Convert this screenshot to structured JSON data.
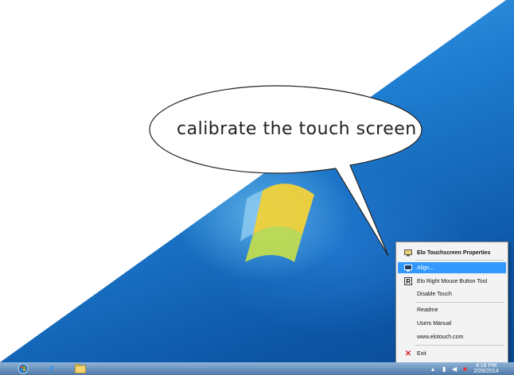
{
  "callout": {
    "text": "calibrate the touch screen"
  },
  "context_menu": {
    "items": [
      {
        "id": "elo-touchscreen-properties",
        "label": "Elo Touchscreen Properties",
        "icon": "elo-monitor-icon",
        "style": "bold"
      },
      {
        "id": "align",
        "label": "Align...",
        "icon": "align-monitor-icon",
        "style": "selected"
      },
      {
        "id": "elo-right-mouse-button-tool",
        "label": "Elo Right Mouse Button Tool",
        "icon": "right-button-r-icon",
        "style": "normal"
      },
      {
        "id": "disable-touch",
        "label": "Disable Touch",
        "style": "plain"
      },
      {
        "id": "readme",
        "label": "Readme",
        "style": "plain"
      },
      {
        "id": "users-manual",
        "label": "Users Manual",
        "style": "plain"
      },
      {
        "id": "elotouch-website",
        "label": "www.elotouch.com",
        "style": "plain"
      },
      {
        "id": "exit",
        "label": "Exit",
        "icon": "red-x-icon",
        "style": "normal"
      }
    ]
  },
  "taskbar": {
    "clock_time": "4:16 PM",
    "clock_date": "2/28/2014",
    "pinned": [
      "start-orb-icon",
      "internet-explorer-icon",
      "file-explorer-icon"
    ],
    "tray_icons": [
      "show-hidden-icons-chevron-icon",
      "network-icon",
      "volume-icon",
      "elo-tray-icon"
    ]
  },
  "colors": {
    "selection": "#3399ff",
    "wallpaper": "#1f7fd2",
    "menu_background": "#f3f3f3"
  }
}
